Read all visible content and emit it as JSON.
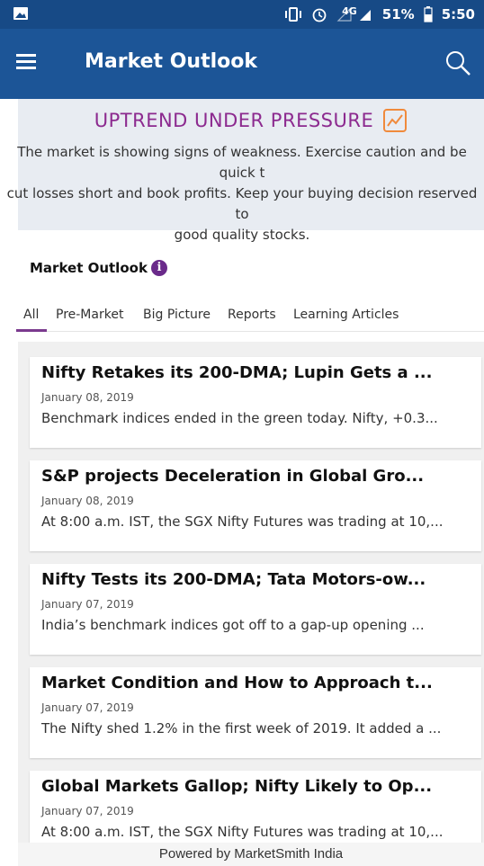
{
  "status_bar": {
    "network": "4G",
    "battery": "51%",
    "time": "5:50"
  },
  "app_bar": {
    "title": "Market Outlook"
  },
  "banner": {
    "headline": "UPTREND UNDER PRESSURE",
    "text_lines": [
      "The market is showing signs of weakness. Exercise caution and be quick t",
      "cut losses short and book profits. Keep your buying decision reserved to",
      "good quality stocks."
    ]
  },
  "section": {
    "title": "Market Outlook"
  },
  "tabs": [
    "All",
    "Pre-Market",
    "Big Picture",
    "Reports",
    "Learning Articles"
  ],
  "active_tab": "All",
  "articles": [
    {
      "title": "Nifty Retakes its 200-DMA; Lupin Gets a ...",
      "date": "January 08, 2019",
      "excerpt": "Benchmark indices ended in the green today. Nifty, +0.3..."
    },
    {
      "title": "S&P projects Deceleration in Global Gro...",
      "date": "January 08, 2019",
      "excerpt": "At 8:00 a.m. IST, the SGX Nifty Futures was trading at 10,..."
    },
    {
      "title": "Nifty Tests its 200-DMA; Tata Motors-ow...",
      "date": "January 07, 2019",
      "excerpt": "India’s benchmark indices got off to a gap-up opening ..."
    },
    {
      "title": "Market Condition and How to Approach t...",
      "date": "January 07, 2019",
      "excerpt": "The Nifty shed 1.2% in the first week of 2019. It added a ..."
    },
    {
      "title": "Global Markets Gallop; Nifty Likely to Op...",
      "date": "January 07, 2019",
      "excerpt": "At 8:00 a.m. IST, the SGX Nifty Futures was trading at 10,..."
    }
  ],
  "footer": "Powered by MarketSmith India",
  "colors": {
    "status_bar": "#174a86",
    "app_bar": "#1c5597",
    "headline": "#8c2a8f",
    "trend_icon": "#f08a3c",
    "tab_underline": "#7b3a8e"
  },
  "icons": [
    "image-icon",
    "vibrate-icon",
    "alarm-icon",
    "signal-icon",
    "battery-icon",
    "menu-icon",
    "search-icon",
    "trend-chart-icon",
    "info-icon"
  ]
}
